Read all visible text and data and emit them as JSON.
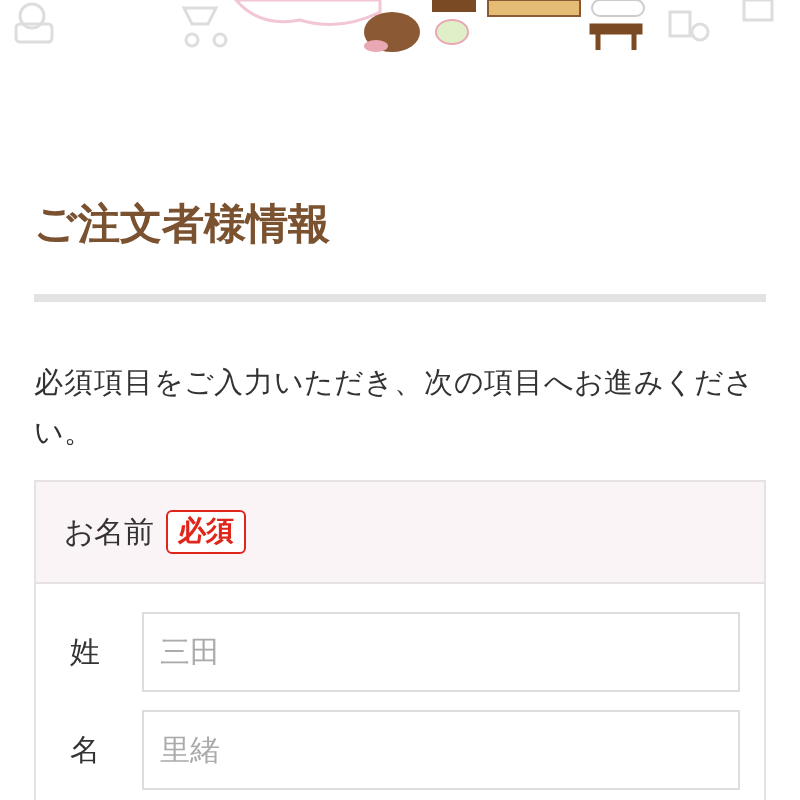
{
  "section": {
    "title": "ご注文者様情報",
    "intro": "必須項目をご入力いただき、次の項目へお進みください。"
  },
  "form_group": {
    "label": "お名前",
    "required": true,
    "required_badge": "必須",
    "fields": [
      {
        "label": "姓",
        "placeholder": "三田"
      },
      {
        "label": "名",
        "placeholder": "里緒"
      }
    ]
  }
}
